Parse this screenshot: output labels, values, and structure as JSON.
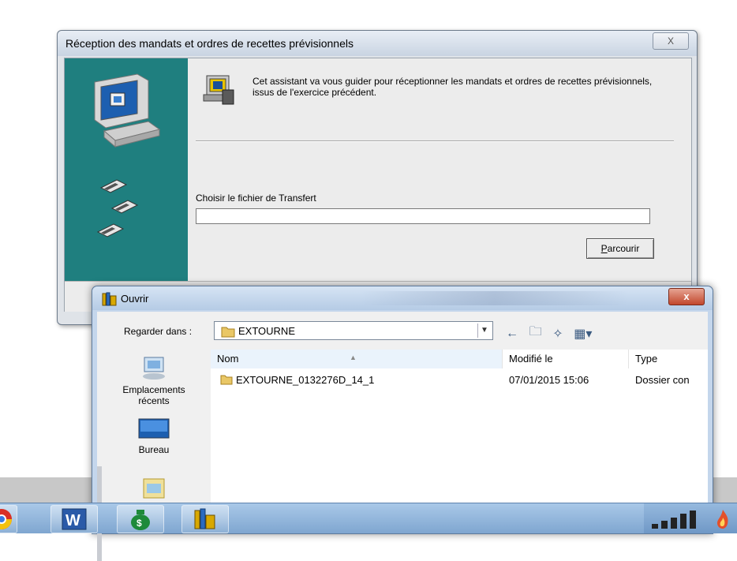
{
  "wizard": {
    "title": "Réception des mandats et ordres de recettes prévisionnels",
    "close_label": "X",
    "intro_text": "Cet assistant va vous guider pour réceptionner les mandats et ordres de recettes prévisionnels, issus de l'exercice précédent.",
    "file_label": "Choisir le fichier de Transfert",
    "file_value": "",
    "browse_first_letter": "P",
    "browse_rest": "arcourir"
  },
  "open_dialog": {
    "title": "Ouvrir",
    "close_label": "x",
    "look_in_label": "Regarder dans :",
    "look_in_value": "EXTOURNE",
    "places": [
      {
        "label_line1": "Emplacements",
        "label_line2": "récents"
      },
      {
        "label_line1": "Bureau",
        "label_line2": ""
      }
    ],
    "columns": {
      "name": "Nom",
      "modified": "Modifié le",
      "type": "Type"
    },
    "files": [
      {
        "name": "EXTOURNE_0132276D_14_1",
        "modified": "07/01/2015 15:06",
        "type": "Dossier con"
      }
    ]
  },
  "colors": {
    "teal_panel": "#1f7f7f",
    "dialog_frame": "#c4d6ec",
    "close_red": "#c2472c"
  }
}
